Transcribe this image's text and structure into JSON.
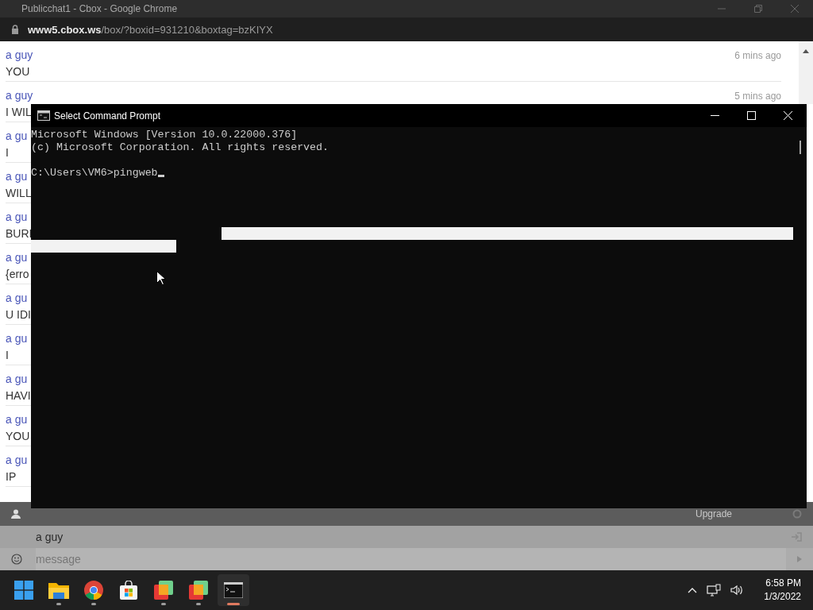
{
  "browser": {
    "title": "Publicchat1 - Cbox - Google Chrome",
    "url_host": "www5.cbox.ws",
    "url_path": "/box/?boxid=931210&boxtag=bzKIYX"
  },
  "chat": {
    "messages": [
      {
        "name": "a guy",
        "text": "YOU",
        "time": "6 mins ago"
      },
      {
        "name": "a guy",
        "text": "I WIL",
        "time": "5 mins ago"
      },
      {
        "name": "a gu",
        "text": "I"
      },
      {
        "name": "a gu",
        "text": "WILL"
      },
      {
        "name": "a gu",
        "text": "BURI"
      },
      {
        "name": "a gu",
        "text": "{erro"
      },
      {
        "name": "a gu",
        "text": "U IDI"
      },
      {
        "name": "a gu",
        "text": "I"
      },
      {
        "name": "a gu",
        "text": "HAVI"
      },
      {
        "name": "a gu",
        "text": "YOU"
      },
      {
        "name": "a gu",
        "text": "IP"
      }
    ]
  },
  "chat_footer": {
    "upgrade": "Upgrade",
    "username": "a guy",
    "message_placeholder": "message"
  },
  "console": {
    "title": "Select Command Prompt",
    "banner": [
      "Microsoft Windows [Version 10.0.22000.376]",
      "(c) Microsoft Corporation. All rights reserved."
    ],
    "prompt": "C:\\Users\\VM6>pingweb"
  },
  "taskbar": {
    "apps": [
      {
        "kind": "start",
        "running": false,
        "selected": false
      },
      {
        "kind": "explorer",
        "running": true,
        "selected": false
      },
      {
        "kind": "chrome",
        "running": true,
        "selected": false
      },
      {
        "kind": "store",
        "running": false,
        "selected": false
      },
      {
        "kind": "app",
        "running": true,
        "selected": false
      },
      {
        "kind": "app",
        "running": true,
        "selected": false
      },
      {
        "kind": "terminal",
        "running": true,
        "selected": true
      }
    ],
    "time": "6:58 PM",
    "date": "1/3/2022"
  }
}
